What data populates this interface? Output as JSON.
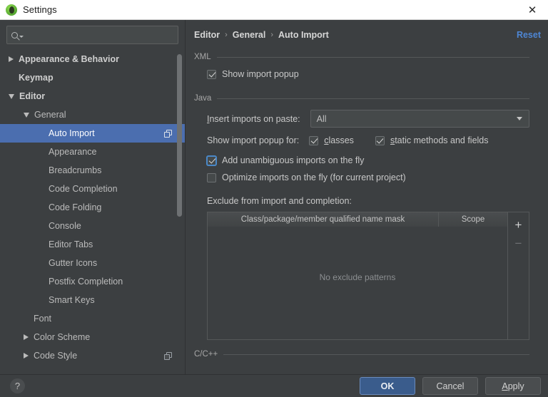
{
  "window": {
    "title": "Settings",
    "app_icon": "intellij-logo-icon",
    "close_icon": "close-icon"
  },
  "sidebar": {
    "search": {
      "value": "",
      "placeholder": "",
      "icon": "search-icon"
    },
    "items": [
      {
        "label": "Appearance & Behavior",
        "indent": 0,
        "twisty": "collapsed",
        "bold": true,
        "selected": false,
        "copy_icon": false
      },
      {
        "label": "Keymap",
        "indent": 0,
        "twisty": "none",
        "bold": true,
        "selected": false,
        "copy_icon": false
      },
      {
        "label": "Editor",
        "indent": 0,
        "twisty": "expanded",
        "bold": true,
        "selected": false,
        "copy_icon": false
      },
      {
        "label": "General",
        "indent": 1,
        "twisty": "expanded",
        "bold": false,
        "selected": false,
        "copy_icon": false
      },
      {
        "label": "Auto Import",
        "indent": 2,
        "twisty": "none",
        "bold": false,
        "selected": true,
        "copy_icon": true
      },
      {
        "label": "Appearance",
        "indent": 2,
        "twisty": "none",
        "bold": false,
        "selected": false,
        "copy_icon": false
      },
      {
        "label": "Breadcrumbs",
        "indent": 2,
        "twisty": "none",
        "bold": false,
        "selected": false,
        "copy_icon": false
      },
      {
        "label": "Code Completion",
        "indent": 2,
        "twisty": "none",
        "bold": false,
        "selected": false,
        "copy_icon": false
      },
      {
        "label": "Code Folding",
        "indent": 2,
        "twisty": "none",
        "bold": false,
        "selected": false,
        "copy_icon": false
      },
      {
        "label": "Console",
        "indent": 2,
        "twisty": "none",
        "bold": false,
        "selected": false,
        "copy_icon": false
      },
      {
        "label": "Editor Tabs",
        "indent": 2,
        "twisty": "none",
        "bold": false,
        "selected": false,
        "copy_icon": false
      },
      {
        "label": "Gutter Icons",
        "indent": 2,
        "twisty": "none",
        "bold": false,
        "selected": false,
        "copy_icon": false
      },
      {
        "label": "Postfix Completion",
        "indent": 2,
        "twisty": "none",
        "bold": false,
        "selected": false,
        "copy_icon": false
      },
      {
        "label": "Smart Keys",
        "indent": 2,
        "twisty": "none",
        "bold": false,
        "selected": false,
        "copy_icon": false
      },
      {
        "label": "Font",
        "indent": 1,
        "twisty": "none",
        "bold": false,
        "selected": false,
        "copy_icon": false
      },
      {
        "label": "Color Scheme",
        "indent": 1,
        "twisty": "collapsed",
        "bold": false,
        "selected": false,
        "copy_icon": false
      },
      {
        "label": "Code Style",
        "indent": 1,
        "twisty": "collapsed",
        "bold": false,
        "selected": false,
        "copy_icon": true
      }
    ]
  },
  "main": {
    "breadcrumb": [
      "Editor",
      "General",
      "Auto Import"
    ],
    "breadcrumb_separator": "›",
    "reset_label": "Reset",
    "xml": {
      "group_label": "XML",
      "show_import_popup": {
        "label": "Show import popup",
        "checked": true
      }
    },
    "java": {
      "group_label": "Java",
      "insert_imports": {
        "label_pre": "I",
        "label_rest": "nsert imports on paste:",
        "value": "All"
      },
      "show_popup_for": {
        "label": "Show import popup for:",
        "classes": {
          "pre": "c",
          "rest": "lasses",
          "checked": true
        },
        "static": {
          "pre": "s",
          "rest": "tatic methods and fields",
          "checked": true
        }
      },
      "add_unambiguous": {
        "label": "Add unambiguous imports on the fly",
        "checked": true,
        "focused": true
      },
      "optimize_imports": {
        "label": "Optimize imports on the fly (for current project)",
        "checked": false
      },
      "exclude_caption": "Exclude from import and completion:",
      "table": {
        "columns": [
          "Class/package/member qualified name mask",
          "Scope"
        ],
        "rows": [],
        "empty_text": "No exclude patterns",
        "add_label": "+",
        "remove_label": "−"
      }
    },
    "cpp": {
      "group_label": "C/C++"
    }
  },
  "footer": {
    "help_label": "?",
    "ok_label": "OK",
    "cancel_label": "Cancel",
    "apply_pre": "A",
    "apply_rest": "pply"
  }
}
